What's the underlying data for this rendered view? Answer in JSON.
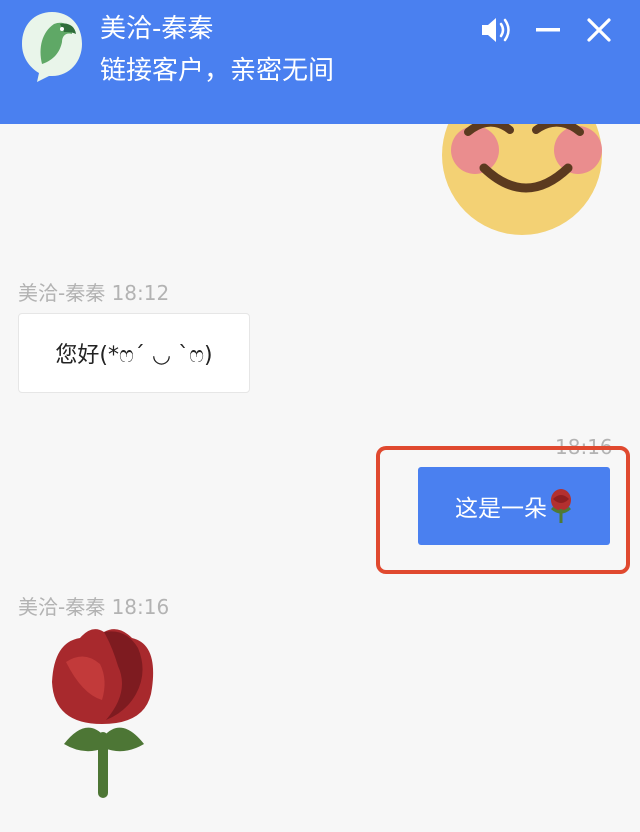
{
  "header": {
    "title": "美洽-秦秦",
    "subtitle": "链接客户，亲密无间",
    "accent_color": "#4a80f0",
    "icons": [
      "parrot-logo-icon",
      "speaker-icon",
      "minimize-icon",
      "close-icon"
    ]
  },
  "messages": [
    {
      "type": "emoji",
      "icon": "smiling-face-icon",
      "direction": "outgoing"
    },
    {
      "sender": "美洽-秦秦",
      "time": "18:12",
      "direction": "incoming",
      "text": "您好(*ෆ´ ◡ `ෆ)"
    },
    {
      "time": "18:16",
      "direction": "outgoing",
      "text": "这是一朵",
      "emoji": "rose-icon"
    },
    {
      "sender": "美洽-秦秦",
      "time": "18:16",
      "direction": "incoming",
      "type": "emoji",
      "icon": "rose-icon"
    }
  ]
}
